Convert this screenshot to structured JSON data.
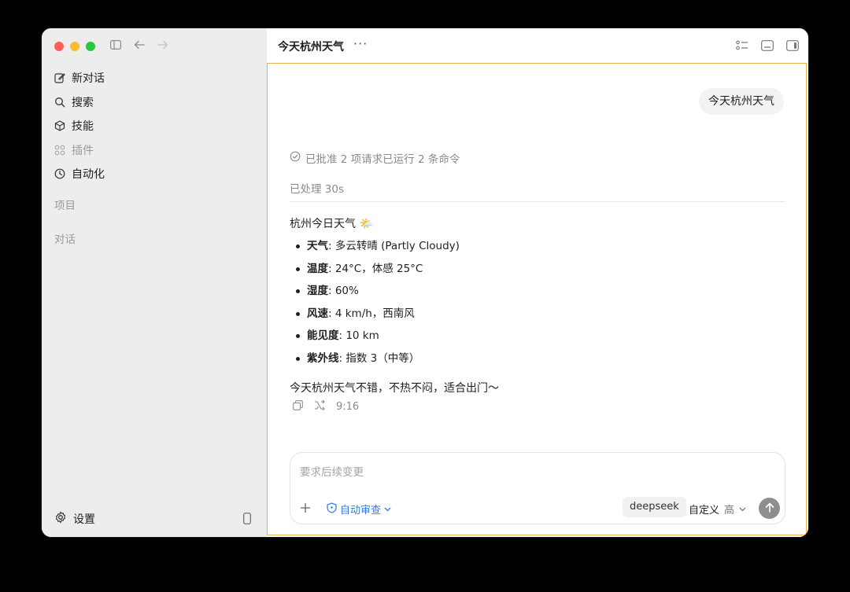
{
  "sidebar": {
    "nav": [
      {
        "label": "新对话",
        "icon": "edit-icon"
      },
      {
        "label": "搜索",
        "icon": "search-icon"
      },
      {
        "label": "技能",
        "icon": "cube-icon"
      },
      {
        "label": "插件",
        "icon": "grid-icon"
      },
      {
        "label": "自动化",
        "icon": "clock-icon"
      }
    ],
    "section_projects": "项目",
    "section_chats": "对话",
    "settings_label": "设置"
  },
  "header": {
    "title": "今天杭州天气",
    "more": "···"
  },
  "chat": {
    "user_message": "今天杭州天气",
    "status": "已批准 2 项请求已运行 2 条命令",
    "processed": "已处理 30s",
    "response_title": "杭州今日天气 🌤️",
    "details": [
      {
        "key": "天气",
        "value": ": 多云转晴 (Partly Cloudy)"
      },
      {
        "key": "温度",
        "value": ": 24°C，体感 25°C"
      },
      {
        "key": "湿度",
        "value": ": 60%"
      },
      {
        "key": "风速",
        "value": ": 4 km/h，西南风"
      },
      {
        "key": "能见度",
        "value": ": 10 km"
      },
      {
        "key": "紫外线",
        "value": ": 指数 3（中等）"
      }
    ],
    "summary": "今天杭州天气不错，不热不闷，适合出门～",
    "time": "9:16"
  },
  "composer": {
    "placeholder": "要求后续变更",
    "auto_review": "自动审查",
    "model": "deepseek",
    "mode": "自定义",
    "level": "高"
  },
  "colors": {
    "accent_border": "#e6b04b",
    "link_blue": "#2f7ce5",
    "sidebar_bg": "#ededed"
  }
}
